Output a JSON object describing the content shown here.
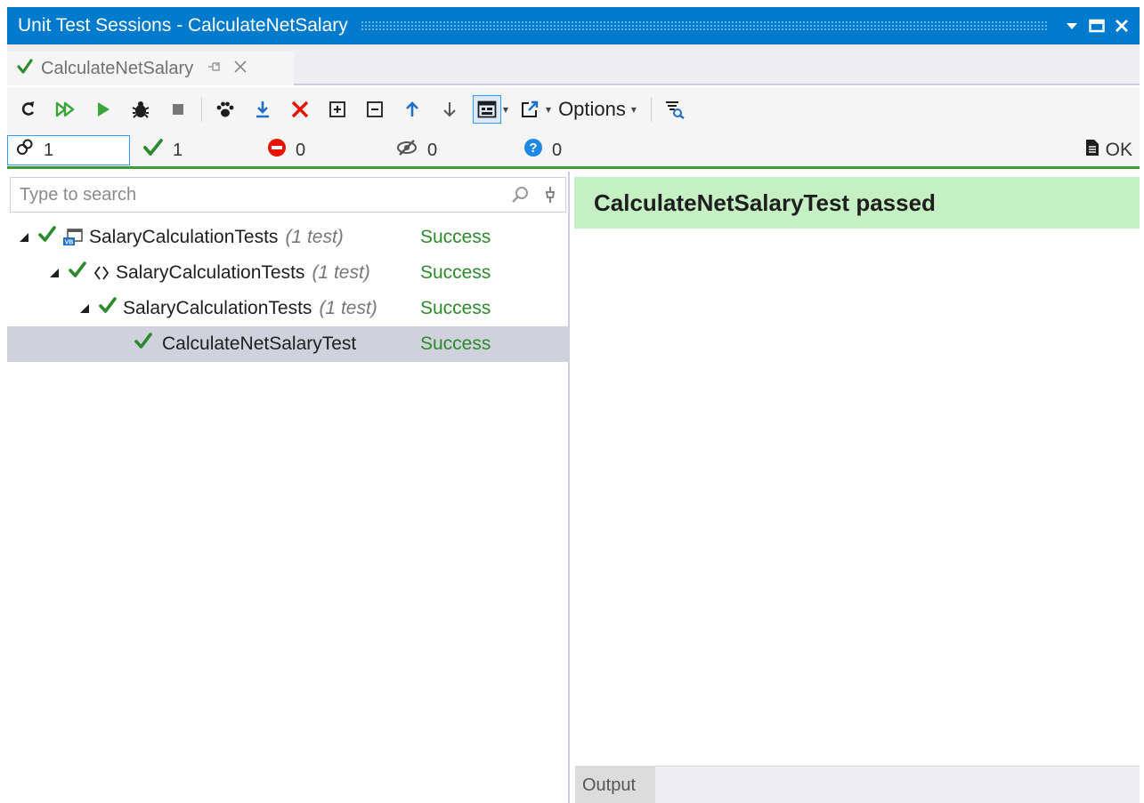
{
  "window": {
    "title": "Unit Test Sessions - CalculateNetSalary",
    "accent": "#007acc"
  },
  "tab": {
    "label": "CalculateNetSalary"
  },
  "toolbar": {
    "options_label": "Options"
  },
  "counters": {
    "total": "1",
    "passed": "1",
    "failed": "0",
    "ignored": "0",
    "inconclusive": "0",
    "output_label": "OK"
  },
  "search": {
    "placeholder": "Type to search"
  },
  "tree": [
    {
      "name": "SalaryCalculationTests",
      "count": "(1 test)",
      "status": "Success",
      "icon": "vb-project-icon"
    },
    {
      "name": "SalaryCalculationTests",
      "count": "(1 test)",
      "status": "Success",
      "icon": "namespace-icon"
    },
    {
      "name": "SalaryCalculationTests",
      "count": "(1 test)",
      "status": "Success",
      "icon": ""
    },
    {
      "name": "CalculateNetSalaryTest",
      "count": "",
      "status": "Success",
      "icon": ""
    }
  ],
  "details": {
    "result_text": "CalculateNetSalaryTest passed",
    "output_tab": "Output"
  },
  "colors": {
    "success": "#2c8a2c",
    "passed_banner": "#c4f0c4",
    "failed": "#e51400"
  }
}
